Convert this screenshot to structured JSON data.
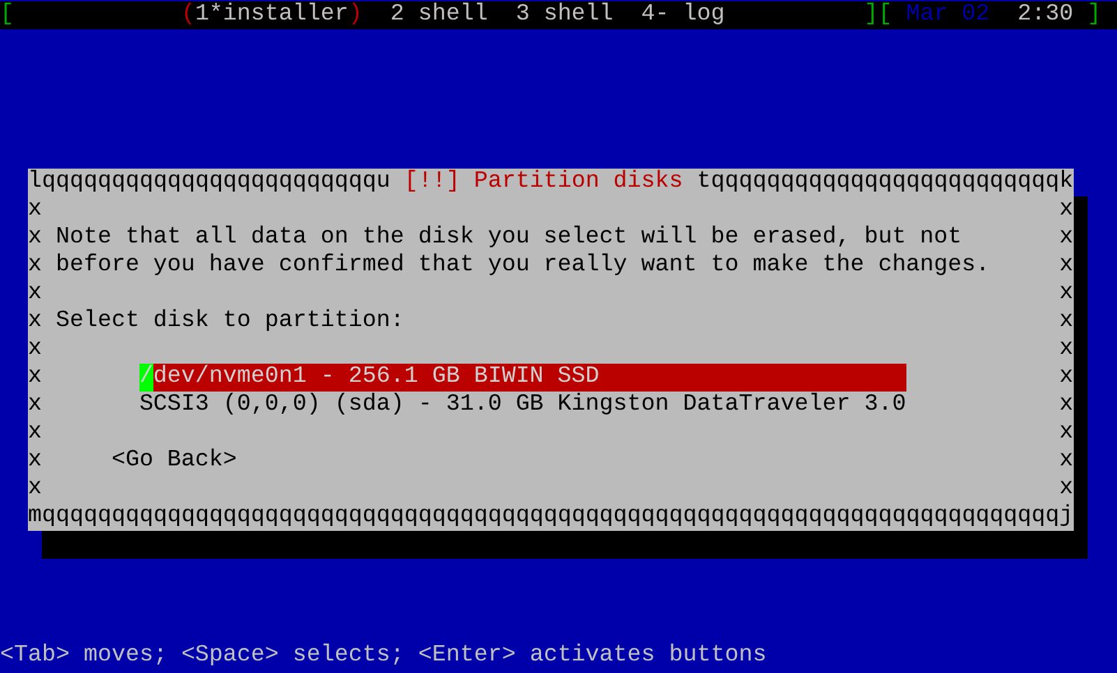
{
  "status_bar": {
    "open_bracket": "[",
    "selected_marks": {
      "open": "(",
      "close": ")"
    },
    "windows": [
      {
        "label": "1*installer",
        "selected": true
      },
      {
        "label": "2 shell",
        "selected": false
      },
      {
        "label": "3 shell",
        "selected": false
      },
      {
        "label": "4- log",
        "selected": false
      }
    ],
    "middle_brackets": "][",
    "date": "Mar 02",
    "time": "2:30",
    "close_bracket": "]"
  },
  "dialog": {
    "rule_left": "lqqqqqqqqqqqqqqqqqqqqqqqqu",
    "title": "[!!] Partition disks",
    "rule_right": "tqqqqqqqqqqqqqqqqqqqqqqqqqk",
    "rows": [
      {
        "kind": "blank",
        "edge_left": "x",
        "edge_right": "x"
      },
      {
        "kind": "text",
        "text": "Note that all data on the disk you select will be erased, but not",
        "edge_left": "x",
        "edge_right": "x"
      },
      {
        "kind": "text",
        "text": "before you have confirmed that you really want to make the changes.",
        "edge_left": "x",
        "edge_right": "x"
      },
      {
        "kind": "blank",
        "edge_left": "x",
        "edge_right": "x"
      },
      {
        "kind": "text",
        "text": "Select disk to partition:",
        "edge_left": "x",
        "edge_right": "x"
      },
      {
        "kind": "blank",
        "edge_left": "x",
        "edge_right": "x"
      },
      {
        "kind": "disk",
        "text": "/dev/nvme0n1 - 256.1 GB BIWIN SSD",
        "selected": true,
        "edge_left": "x",
        "edge_right": "x"
      },
      {
        "kind": "disk",
        "text": "SCSI3 (0,0,0) (sda) - 31.0 GB Kingston DataTraveler 3.0",
        "selected": false,
        "edge_left": "x",
        "edge_right": "x"
      },
      {
        "kind": "blank",
        "edge_left": "x",
        "edge_right": "x"
      },
      {
        "kind": "button",
        "text": "<Go Back>",
        "edge_left": "x",
        "edge_right": "x"
      },
      {
        "kind": "blank",
        "edge_left": "x",
        "edge_right": "x"
      }
    ],
    "rule_bottom": "mqqqqqqqqqqqqqqqqqqqqqqqqqqqqqqqqqqqqqqqqqqqqqqqqqqqqqqqqqqqqqqqqqqqqqqqqqj"
  },
  "hint_bar": {
    "text": "<Tab> moves; <Space> selects; <Enter> activates buttons"
  }
}
